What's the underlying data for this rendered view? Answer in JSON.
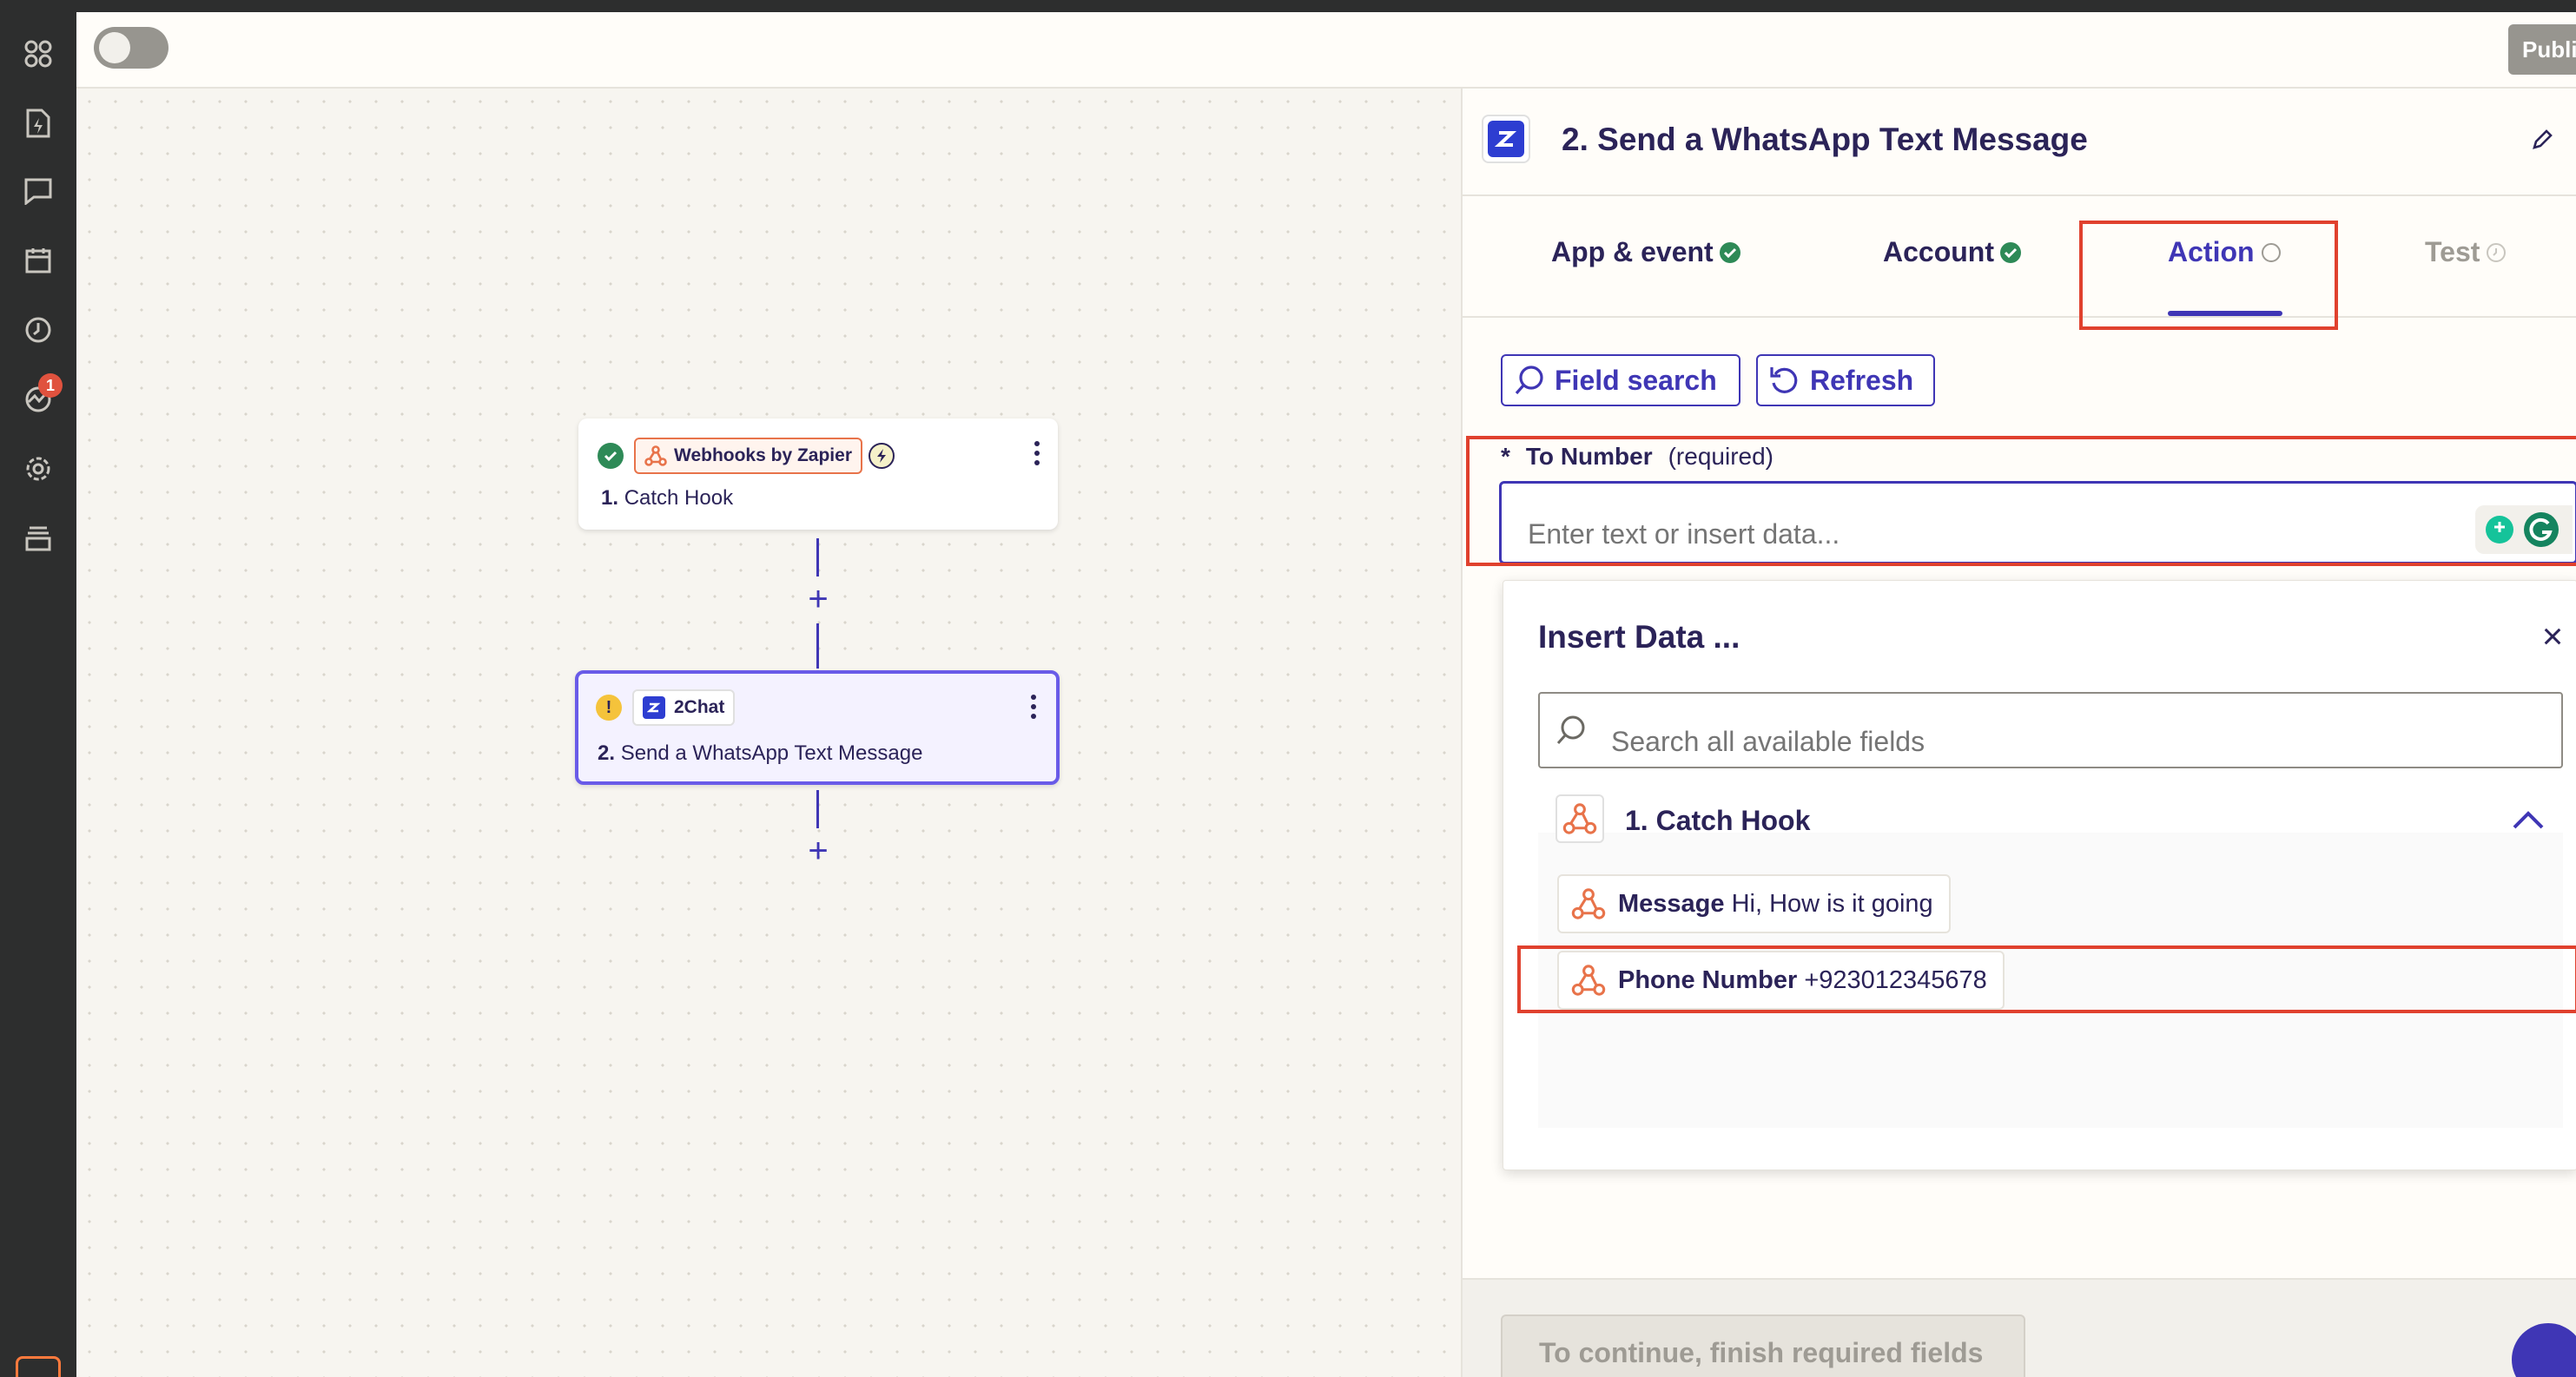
{
  "top_bar": {
    "publish_label": "Publis"
  },
  "rail": {
    "badge_count": "1"
  },
  "canvas": {
    "step1": {
      "app": "Webhooks by Zapier",
      "number": "1.",
      "title": "Catch Hook"
    },
    "step2": {
      "app": "2Chat",
      "number": "2.",
      "title": "Send a WhatsApp Text Message"
    }
  },
  "panel": {
    "title": "2. Send a WhatsApp Text Message",
    "tabs": [
      {
        "label": "App & event",
        "state": "complete"
      },
      {
        "label": "Account",
        "state": "complete"
      },
      {
        "label": "Action",
        "state": "active"
      },
      {
        "label": "Test",
        "state": "disabled"
      }
    ],
    "field_search_label": "Field search",
    "refresh_label": "Refresh",
    "field": {
      "asterisk": "*",
      "label": "To Number",
      "required_text": "(required)",
      "placeholder": "Enter text or insert data..."
    },
    "insert_data": {
      "title": "Insert Data ...",
      "search_placeholder": "Search all available fields",
      "group_label": "1. Catch Hook",
      "items": [
        {
          "key": "Message",
          "value": "Hi, How is it going"
        },
        {
          "key": "Phone Number",
          "value": "+923012345678"
        }
      ]
    },
    "continue_label": "To continue, finish required fields"
  },
  "colors": {
    "accent": "#3f36b5",
    "highlight": "#e0412e",
    "success": "#2e8a57",
    "warning": "#f5c33b",
    "webhook": "#e8734a"
  }
}
